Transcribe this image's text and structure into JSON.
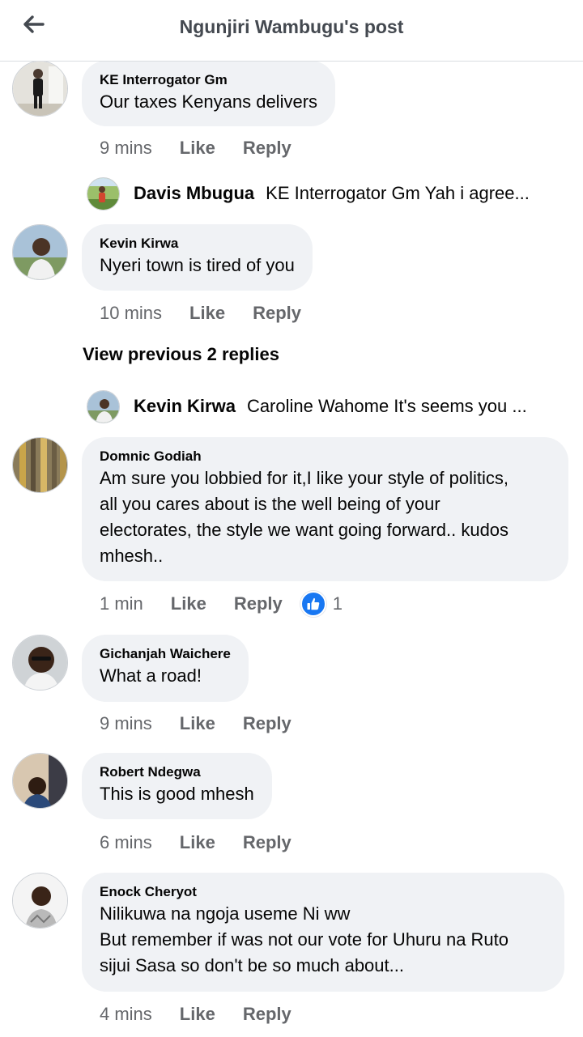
{
  "header": {
    "title": "Ngunjiri Wambugu's post",
    "back_icon": "arrow-left-icon"
  },
  "actions": {
    "like": "Like",
    "reply": "Reply"
  },
  "comments": [
    {
      "author": "KE Interrogator Gm",
      "text": "Our taxes Kenyans delivers",
      "time": "9 mins"
    },
    {
      "author": "Kevin Kirwa",
      "text": "Nyeri town is tired of you",
      "time": "10 mins"
    },
    {
      "author": "Domnic Godiah",
      "text": "Am sure you lobbied for it,I like your style of politics,\nall you cares about is the well being of your\nelectorates, the style we want going forward.. kudos\nmhesh..",
      "time": "1 min",
      "reaction_count": "1",
      "reaction_icon": "like-icon"
    },
    {
      "author": "Gichanjah Waichere",
      "text": "What a road!",
      "time": "9 mins"
    },
    {
      "author": "Robert Ndegwa",
      "text": "This is good mhesh",
      "time": "6 mins"
    },
    {
      "author": "Enock Cheryot",
      "text": "Nilikuwa na ngoja useme Ni ww\nBut remember if was not our vote for Uhuru na Ruto\nsijui Sasa so don't be so much about...",
      "time": "4 mins"
    }
  ],
  "replies": [
    {
      "author": "Davis Mbugua",
      "text": "KE Interrogator Gm Yah i agree..."
    },
    {
      "author": "Kevin Kirwa",
      "text": "Caroline Wahome It's seems you ..."
    }
  ],
  "view_previous": "View previous 2 replies",
  "colors": {
    "bubble": "#f0f2f5",
    "meta": "#65676b",
    "like_blue": "#1877f2",
    "divider": "#dadde1"
  }
}
